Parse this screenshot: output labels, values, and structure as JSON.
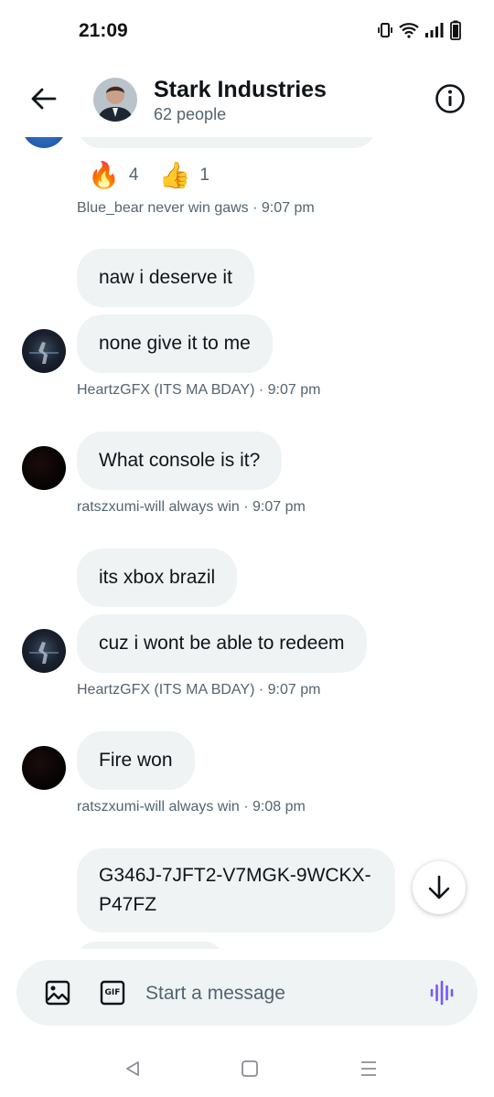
{
  "status_bar": {
    "time": "21:09"
  },
  "header": {
    "title": "Stark Industries",
    "subtitle": "62 people"
  },
  "reactions": [
    {
      "emoji": "🔥",
      "icon": "fire-emoji",
      "count": "4"
    },
    {
      "emoji": "👍",
      "icon": "thumbs-up-emoji",
      "count": "1"
    }
  ],
  "messages": [
    {
      "text": "naw i deserve it"
    },
    {
      "text": "none give it to me"
    },
    {
      "text": "What console is it?"
    },
    {
      "text": "its xbox brazil"
    },
    {
      "text": "cuz i wont be able to redeem"
    },
    {
      "text": "Fire won"
    },
    {
      "text": "G346J-7JFT2-V7MGK-9WCKX-P47FZ"
    }
  ],
  "meta": [
    "Blue_bear never win gaws · 9:07 pm",
    "HeartzGFX (ITS MA BDAY) · 9:07 pm",
    "ratszxumi-will always win · 9:07 pm",
    "HeartzGFX (ITS MA BDAY) · 9:07 pm",
    "ratszxumi-will always win · 9:08 pm"
  ],
  "composer": {
    "placeholder": "Start a message",
    "gif_label": "GIF"
  },
  "colors": {
    "bubble": "#eff3f4",
    "meta_text": "#536471",
    "voice_accent": "#7856ff"
  }
}
